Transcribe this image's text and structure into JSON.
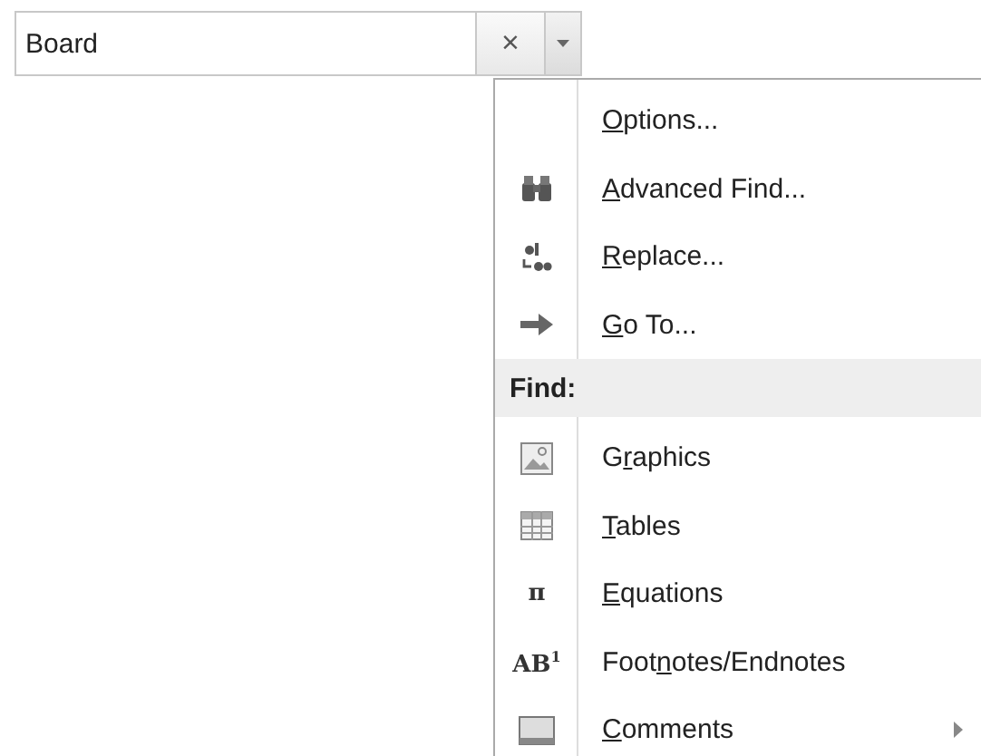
{
  "search": {
    "value": "Board",
    "clear_button": "×"
  },
  "menu": {
    "items": [
      {
        "kind": "command",
        "label": "Options...",
        "submenu": false
      },
      {
        "kind": "command",
        "label": "Advanced Find...",
        "submenu": false
      },
      {
        "kind": "command",
        "label": "Replace...",
        "submenu": false
      },
      {
        "kind": "command",
        "label": "Go To...",
        "submenu": false
      },
      {
        "kind": "header",
        "label": "Find:"
      },
      {
        "kind": "command",
        "label": "Graphics",
        "submenu": false
      },
      {
        "kind": "command",
        "label": "Tables",
        "submenu": false
      },
      {
        "kind": "command",
        "glyph": "π",
        "label": "Equations",
        "submenu": false
      },
      {
        "kind": "command",
        "glyph": "AB$^{1}$",
        "label": "Footnotes/Endnotes",
        "submenu": false
      },
      {
        "kind": "command",
        "label": "Comments",
        "submenu": true
      }
    ]
  }
}
